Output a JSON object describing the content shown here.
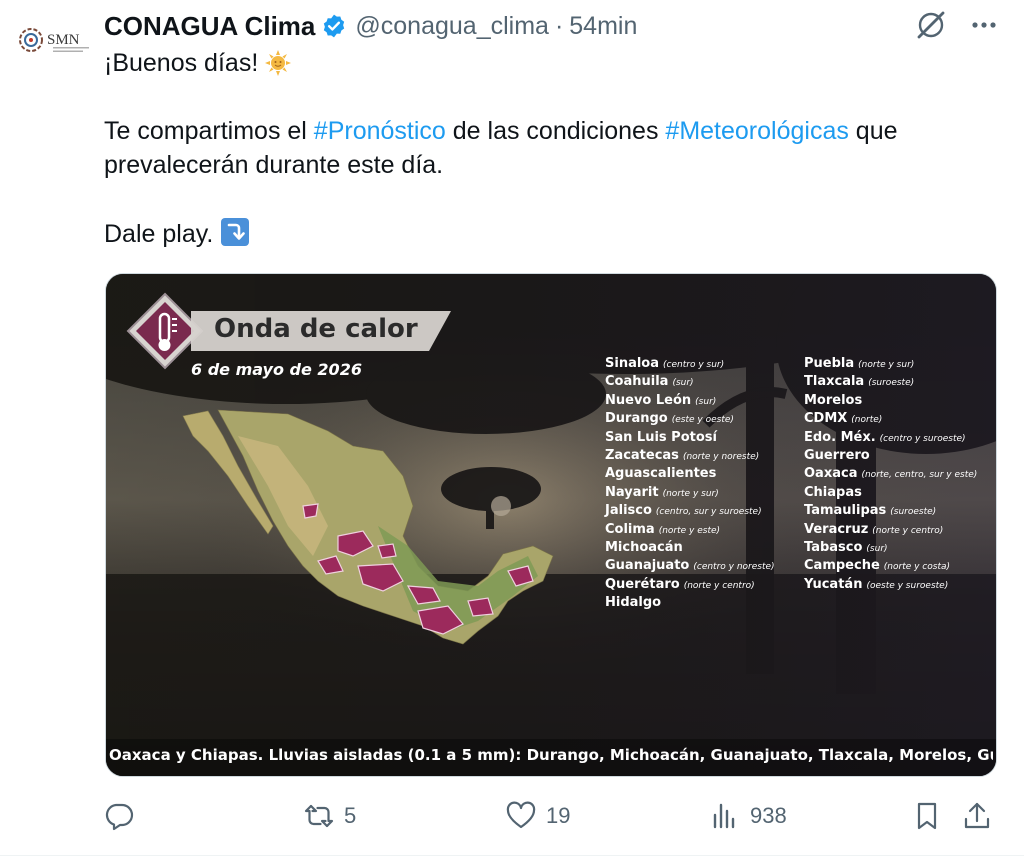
{
  "tweet": {
    "author_name": "CONAGUA Clima",
    "handle": "@conagua_clima",
    "separator": "·",
    "time": "54min",
    "avatar_text": "SMN",
    "text_line1": "¡Buenos días!",
    "text_p2_a": "Te compartimos el ",
    "hashtag1": "#Pronóstico",
    "text_p2_b": " de las condiciones ",
    "hashtag2": "#Meteorológicas",
    "text_p2_c": " que prevalecerán durante este día.",
    "text_p3": "Dale play."
  },
  "media": {
    "title": "Onda de calor",
    "date": "6 de mayo de 2026",
    "ticker": "Oaxaca y Chiapas. Lluvias aisladas (0.1 a 5 mm): Durango, Michoacán, Guanajuato, Tlaxcala, Morelos, Gu",
    "states_left": [
      {
        "name": "Sinaloa",
        "note": "(centro y sur)"
      },
      {
        "name": "Coahuila",
        "note": "(sur)"
      },
      {
        "name": "Nuevo León",
        "note": "(sur)"
      },
      {
        "name": "Durango",
        "note": "(este y oeste)"
      },
      {
        "name": "San Luis Potosí",
        "note": ""
      },
      {
        "name": "Zacatecas",
        "note": "(norte y noreste)"
      },
      {
        "name": "Aguascalientes",
        "note": ""
      },
      {
        "name": "Nayarit",
        "note": "(norte y sur)"
      },
      {
        "name": "Jalisco",
        "note": "(centro, sur y suroeste)"
      },
      {
        "name": "Colima",
        "note": "(norte y este)"
      },
      {
        "name": "Michoacán",
        "note": ""
      },
      {
        "name": "Guanajuato",
        "note": "(centro y noreste)"
      },
      {
        "name": "Querétaro",
        "note": "(norte y centro)"
      },
      {
        "name": "Hidalgo",
        "note": ""
      }
    ],
    "states_right": [
      {
        "name": "Puebla",
        "note": "(norte y sur)"
      },
      {
        "name": "Tlaxcala",
        "note": "(suroeste)"
      },
      {
        "name": "Morelos",
        "note": ""
      },
      {
        "name": "CDMX",
        "note": "(norte)"
      },
      {
        "name": "Edo. Méx.",
        "note": "(centro y suroeste)"
      },
      {
        "name": "Guerrero",
        "note": ""
      },
      {
        "name": "Oaxaca",
        "note": "(norte, centro, sur y este)"
      },
      {
        "name": "Chiapas",
        "note": ""
      },
      {
        "name": "Tamaulipas",
        "note": "(suroeste)"
      },
      {
        "name": "Veracruz",
        "note": "(norte y centro)"
      },
      {
        "name": "Tabasco",
        "note": "(sur)"
      },
      {
        "name": "Campeche",
        "note": "(norte y costa)"
      },
      {
        "name": "Yucatán",
        "note": "(oeste y suroeste)"
      }
    ]
  },
  "actions": {
    "retweets": "5",
    "likes": "19",
    "views": "938"
  },
  "icons": {
    "verified": "verified-badge-icon",
    "grok": "grok-icon",
    "more": "more-icon",
    "sun": "sun-emoji-icon",
    "arrow": "arrow-down-emoji-icon",
    "reply": "reply-icon",
    "retweet": "retweet-icon",
    "like": "heart-icon",
    "views": "views-icon",
    "bookmark": "bookmark-icon",
    "share": "share-icon"
  },
  "colors": {
    "hashtag": "#1d9bf0",
    "verified": "#1d9bf0",
    "heat_zone": "#9c2a5c"
  }
}
